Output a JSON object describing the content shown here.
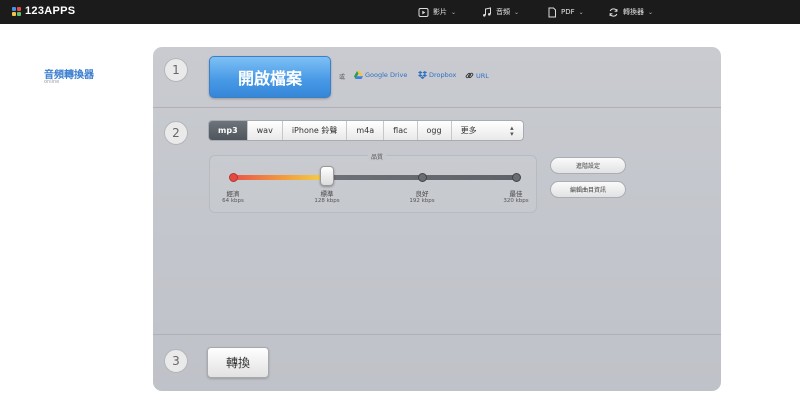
{
  "brand": {
    "logo_text": "123APPS",
    "dot_colors": [
      "#4a90e2",
      "#e94b4b",
      "#f5c34a",
      "#5cc06d"
    ]
  },
  "nav": [
    {
      "label": "影片",
      "icon": "video-icon"
    },
    {
      "label": "音頻",
      "icon": "music-icon"
    },
    {
      "label": "PDF",
      "icon": "document-icon"
    },
    {
      "label": "轉換器",
      "icon": "convert-icon"
    }
  ],
  "sidebar": {
    "title": "音頻轉換器",
    "subtitle": "online"
  },
  "step1": {
    "number": "1",
    "open_button": "開啟檔案",
    "or_text": "或",
    "sources": [
      {
        "label": "Google Drive",
        "icon": "google-drive-icon"
      },
      {
        "label": "Dropbox",
        "icon": "dropbox-icon"
      },
      {
        "label": "URL",
        "icon": "link-icon"
      }
    ]
  },
  "step2": {
    "number": "2",
    "formats": [
      "mp3",
      "wav",
      "iPhone 鈴聲",
      "m4a",
      "flac",
      "ogg"
    ],
    "active_format": "mp3",
    "more_label": "更多",
    "quality": {
      "label": "品質",
      "selected_index": 1,
      "levels": [
        {
          "name": "經濟",
          "rate": "64 kbps"
        },
        {
          "name": "標準",
          "rate": "128 kbps"
        },
        {
          "name": "良好",
          "rate": "192 kbps"
        },
        {
          "name": "最佳",
          "rate": "320 kbps"
        }
      ]
    },
    "advanced_button": "進階設定",
    "track_info_button": "編輯曲目資訊"
  },
  "step3": {
    "number": "3",
    "convert_button": "轉換"
  },
  "colors": {
    "accent": "#3d7fd0",
    "open_button": "#4a9be6",
    "link": "#2f6fc2",
    "topbar": "#1b1b1b"
  }
}
